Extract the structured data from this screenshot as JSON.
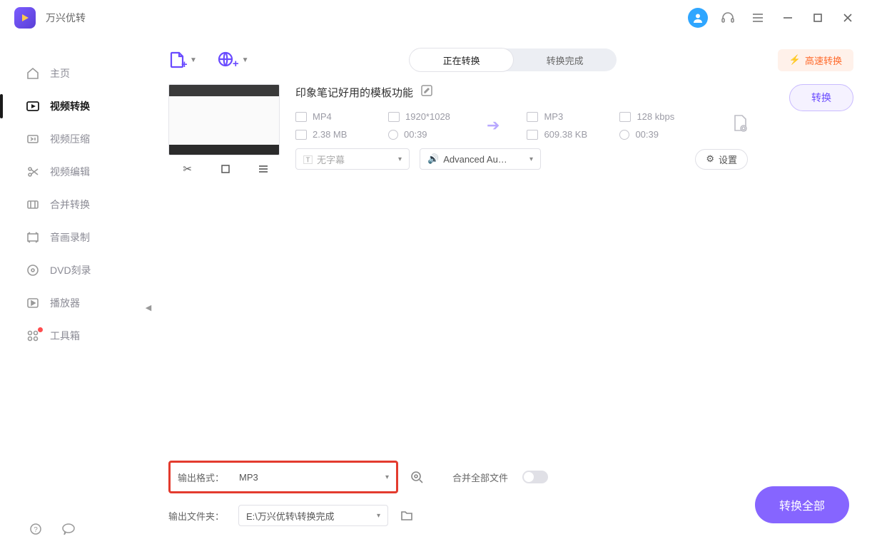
{
  "app": {
    "title": "万兴优转"
  },
  "sidebar": {
    "items": [
      {
        "label": "主页"
      },
      {
        "label": "视频转换"
      },
      {
        "label": "视频压缩"
      },
      {
        "label": "视频编辑"
      },
      {
        "label": "合并转换"
      },
      {
        "label": "音画录制"
      },
      {
        "label": "DVD刻录"
      },
      {
        "label": "播放器"
      },
      {
        "label": "工具箱"
      }
    ]
  },
  "tabs": {
    "converting": "正在转换",
    "done": "转换完成"
  },
  "turbo": "高速转换",
  "file": {
    "title": "印象笔记好用的模板功能",
    "src": {
      "format": "MP4",
      "resolution": "1920*1028",
      "size": "2.38 MB",
      "duration": "00:39"
    },
    "dst": {
      "format": "MP3",
      "bitrate": "128 kbps",
      "size": "609.38 KB",
      "duration": "00:39"
    },
    "convert_label": "转换",
    "subtitle_placeholder": "无字幕",
    "audio_select": "Advanced Au…",
    "settings_label": "设置"
  },
  "bottom": {
    "format_label": "输出格式：",
    "format_value": "MP3",
    "folder_label": "输出文件夹：",
    "folder_value": "E:\\万兴优转\\转换完成",
    "merge_label": "合并全部文件",
    "convert_all": "转换全部"
  }
}
